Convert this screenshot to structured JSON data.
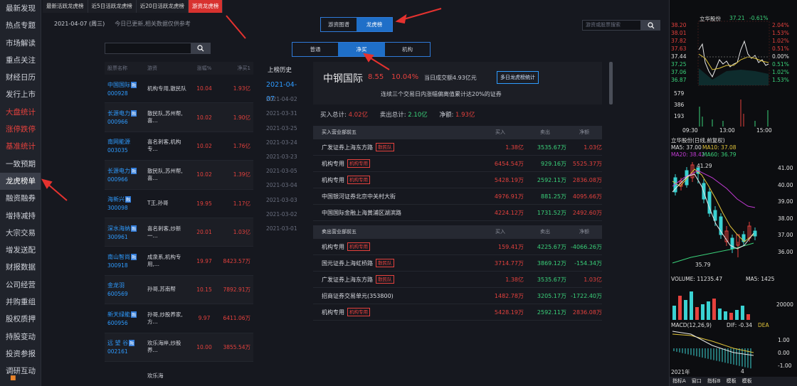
{
  "nav": [
    "最新发现",
    "热点专题",
    "市场解读",
    "重点关注",
    "财经日历",
    "发行上市",
    "大盘统计",
    "涨停跌停",
    "基准统计",
    "一致预期",
    "龙虎榜单",
    "融资融券",
    "增持减持",
    "大宗交易",
    "增发送配",
    "财报数据",
    "公司经营",
    "并购重组",
    "股权质押",
    "持股变动",
    "投资参报",
    "调研互动"
  ],
  "top_tabs": [
    "最新活跃龙虎榜",
    "近5日活跃龙虎榜",
    "近20日活跃龙虎榜",
    "游资龙虎榜"
  ],
  "date": "2021-04-07 (周三)",
  "date_note": "今日已更新,相关数据仅供参考",
  "left_table": {
    "headers": [
      "股票名称",
      "游资",
      "涨幅%",
      "净买1"
    ],
    "rows": [
      {
        "name": "中国国际",
        "tag": "融",
        "code": "000928",
        "seat": "机构专用,散民队",
        "pct": "10.04",
        "net": "1.93亿"
      },
      {
        "name": "长源电力",
        "tag": "融",
        "code": "000966",
        "seat": "散民队,苏州帮,喜...",
        "pct": "10.02",
        "net": "1.90亿"
      },
      {
        "name": "南网能源",
        "tag": "",
        "code": "003035",
        "seat": "喜名刺客,机构专...",
        "pct": "10.02",
        "net": "1.76亿"
      },
      {
        "name": "长源电力",
        "tag": "融",
        "code": "000966",
        "seat": "散民队,苏州帮,喜...",
        "pct": "10.02",
        "net": "1.39亿"
      },
      {
        "name": "海新兴",
        "tag": "融",
        "code": "300098",
        "seat": "T王,孙哥",
        "pct": "19.95",
        "net": "1.17亿"
      },
      {
        "name": "深水海纳",
        "tag": "融",
        "code": "300961",
        "seat": "喜名刺客,炒新一...",
        "pct": "20.01",
        "net": "1.03亿"
      },
      {
        "name": "南山智尚",
        "tag": "融",
        "code": "300918",
        "seat": "成泉系,机构专用,...",
        "pct": "19.97",
        "net": "8423.57万"
      },
      {
        "name": "金龙羽",
        "tag": "",
        "code": "600569",
        "seat": "孙哥,苏南帮",
        "pct": "10.15",
        "net": "7892.91万"
      },
      {
        "name": "新天绿能",
        "tag": "融",
        "code": "600956",
        "seat": "孙哥,炒股养家,方...",
        "pct": "9.97",
        "net": "6411.06万"
      },
      {
        "name": "远 望 谷",
        "tag": "融",
        "code": "002161",
        "seat": "欢乐海岸,炒股养...",
        "pct": "10.00",
        "net": "3855.54万"
      },
      {
        "name": "",
        "tag": "",
        "code": "",
        "seat": "欢乐海",
        "pct": "",
        "net": ""
      }
    ]
  },
  "seg1": [
    "游资图谱",
    "龙虎榜"
  ],
  "seg2": [
    "普通",
    "净买",
    "机构"
  ],
  "history": {
    "title": "上榜历史",
    "dates": [
      "2021-04-07",
      "2021-04-02",
      "2021-03-31",
      "2021-03-25",
      "2021-03-24",
      "2021-03-23",
      "2021-03-05",
      "2021-03-04",
      "2021-03-03",
      "2021-03-02",
      "2021-03-01"
    ]
  },
  "detail": {
    "name": "中钢国际",
    "price": "8.55",
    "pct": "10.04%",
    "amount": "当日成交额4.93亿元",
    "button": "多日龙虎榜统计",
    "reason": "连续三个交易日内涨幅偏离值累计达20%的证券",
    "buy_total_label": "买入总计:",
    "buy_total": "4.02亿",
    "sell_total_label": "卖出总计:",
    "sell_total": "2.10亿",
    "net_label": "净额:",
    "net": "1.93亿",
    "buy_head": [
      "买入营业部前五",
      "买入",
      "卖出",
      "净额"
    ],
    "buy_rows": [
      {
        "name": "广发证券上海东方路",
        "badge": "散民队",
        "buy": "1.38亿",
        "sell": "3535.67万",
        "net": "1.03亿"
      },
      {
        "name": "机构专用",
        "badge": "机构专用",
        "buy": "6454.54万",
        "sell": "929.16万",
        "net": "5525.37万"
      },
      {
        "name": "机构专用",
        "badge": "机构专用",
        "buy": "5428.19万",
        "sell": "2592.11万",
        "net": "2836.08万"
      },
      {
        "name": "中国银河证券北京中关村大街",
        "badge": "",
        "buy": "4976.91万",
        "sell": "881.25万",
        "net": "4095.66万"
      },
      {
        "name": "中国国际金融上海黄浦区湖滨路",
        "badge": "",
        "buy": "4224.12万",
        "sell": "1731.52万",
        "net": "2492.60万"
      }
    ],
    "sell_head": [
      "卖出营业部前五",
      "买入",
      "卖出",
      "净额"
    ],
    "sell_rows": [
      {
        "name": "机构专用",
        "badge": "机构专用",
        "buy": "159.41万",
        "sell": "4225.67万",
        "net": "-4066.26万"
      },
      {
        "name": "国元证券上海虹桥路",
        "badge": "散民队",
        "buy": "3714.77万",
        "sell": "3869.12万",
        "net": "-154.34万"
      },
      {
        "name": "广发证券上海东方路",
        "badge": "散民队",
        "buy": "1.38亿",
        "sell": "3535.67万",
        "net": "1.03亿"
      },
      {
        "name": "招商证券交易单元(353800)",
        "badge": "",
        "buy": "1482.78万",
        "sell": "3205.17万",
        "net": "-1722.40万"
      },
      {
        "name": "机构专用",
        "badge": "机构专用",
        "buy": "5428.19万",
        "sell": "2592.11万",
        "net": "2836.08万"
      }
    ]
  },
  "search_placeholder": "游资或股票搜索",
  "right": {
    "stock": "立华股份",
    "price": "37.21",
    "chg": "-0.61%",
    "left_prices": [
      "38.20",
      "38.01",
      "37.82",
      "37.63",
      "37.44",
      "37.25",
      "37.06",
      "36.87"
    ],
    "right_pcts": [
      "2.04%",
      "1.53%",
      "1.02%",
      "0.51%",
      "0.00%",
      "0.51%",
      "1.02%",
      "1.53%"
    ],
    "vols": [
      "579",
      "386",
      "193"
    ],
    "times": [
      "09:30",
      "13:00",
      "15:00"
    ],
    "k_title": "立华股份(日线,前复权)",
    "ma5": "MA5: 37.00",
    "ma10": "MA10: 37.08",
    "ma20": "MA20: 38.42",
    "ma60": "MA60: 36.79",
    "k_high": "41.29",
    "k_low": "35.79",
    "k_axis": [
      "41.00",
      "40.00",
      "39.00",
      "38.00",
      "37.00",
      "36.00"
    ],
    "vol_label": "VOLUME: 11235.47",
    "vol_ma5": "MA5: 1425",
    "vol_axis": "20000",
    "macd_label": "MACD(12,26,9)",
    "dif": "DIF: -0.34",
    "dea": "DEA",
    "macd_axis": [
      "1.00",
      "0.00",
      "-1.00"
    ],
    "x_label": "2021年",
    "x_mid": "4",
    "bottom": [
      "指标A",
      "窗口",
      "指标B",
      "模板",
      "模板"
    ]
  }
}
